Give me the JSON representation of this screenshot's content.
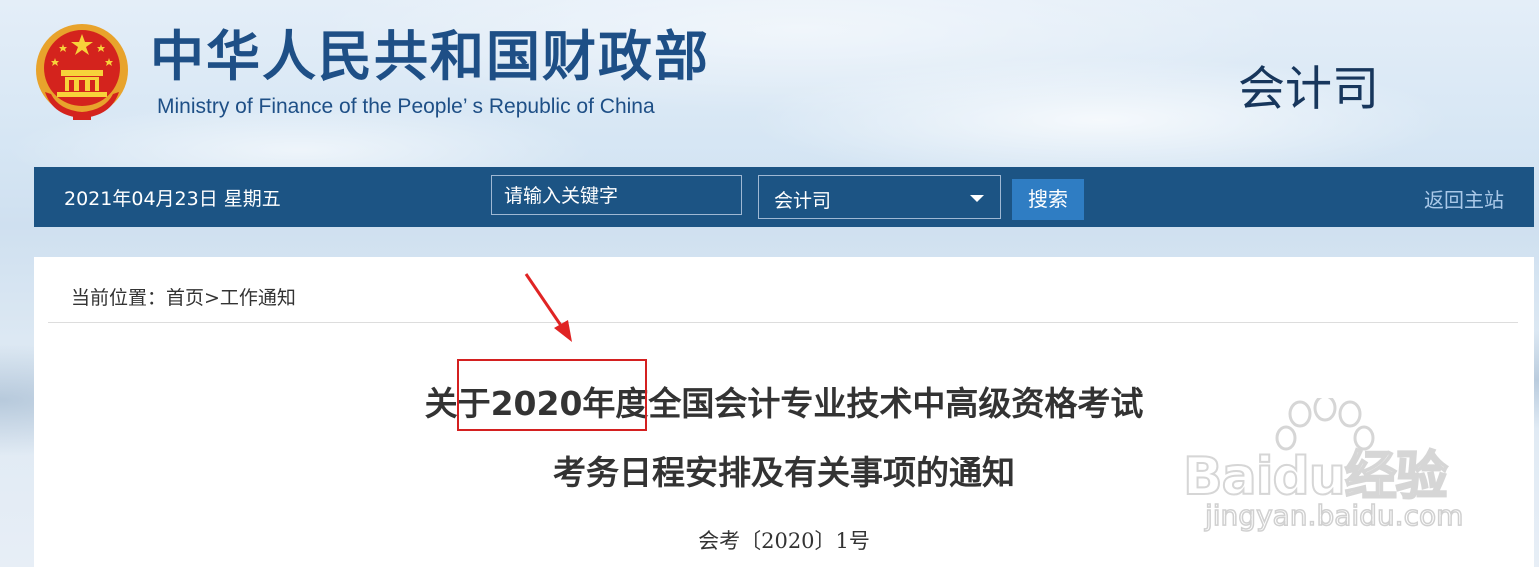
{
  "header": {
    "site_title_cn": "中华人民共和国财政部",
    "site_title_en": "Ministry of Finance of the People’ s Republic of China",
    "department": "会计司"
  },
  "navbar": {
    "date": "2021年04月23日  星期五",
    "search_placeholder": "请输入关键字",
    "scope_select_value": "会计司",
    "search_button": "搜索",
    "home_link": "返回主站"
  },
  "breadcrumb": {
    "text": "当前位置：首页>工作通知"
  },
  "article": {
    "title_line1": "关于2020年度全国会计专业技术中高级资格考试",
    "title_line2": "考务日程安排及有关事项的通知",
    "doc_number": "会考〔2020〕1号"
  },
  "annotation": {
    "highlight_color": "#d42020"
  },
  "watermark": {
    "brand": "Baidu经验",
    "url": "jingyan.baidu.com"
  },
  "colors": {
    "navbar_bg": "#1c5484",
    "title_blue": "#1e4f86",
    "button_blue": "#2f7dc3"
  }
}
